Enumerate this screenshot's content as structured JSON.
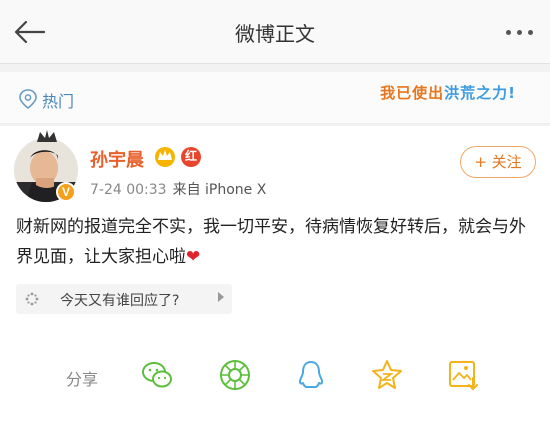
{
  "header": {
    "title": "微博正文",
    "back_icon": "arrow-left-icon",
    "more_icon": "more-dots-icon"
  },
  "hot": {
    "label": "热门",
    "slogan_part1": "我已使出",
    "slogan_part2": "洪荒之力!"
  },
  "post": {
    "username": "孙宇晨",
    "verified_badge": "V",
    "vip_badge_text": "红",
    "time": "7-24 00:33",
    "source": "来自 iPhone X",
    "follow_label": "+ 关注",
    "text": "财新网的报道完全不实，我一切平安，待病情恢复好转后，就会与外界见面，让大家担心啦",
    "heart": "❤",
    "topic_label": "今天又有谁回应了?"
  },
  "share": {
    "label": "分享",
    "targets": [
      "wechat-icon",
      "moments-icon",
      "qq-icon",
      "qzone-icon",
      "save-image-icon"
    ]
  },
  "colors": {
    "accent_orange": "#e8761d",
    "username": "#e8602c",
    "link_blue": "#4a88b8",
    "share_green": "#5bbf3c",
    "share_blue": "#4aa8e0",
    "share_yellow": "#f3b31b"
  }
}
